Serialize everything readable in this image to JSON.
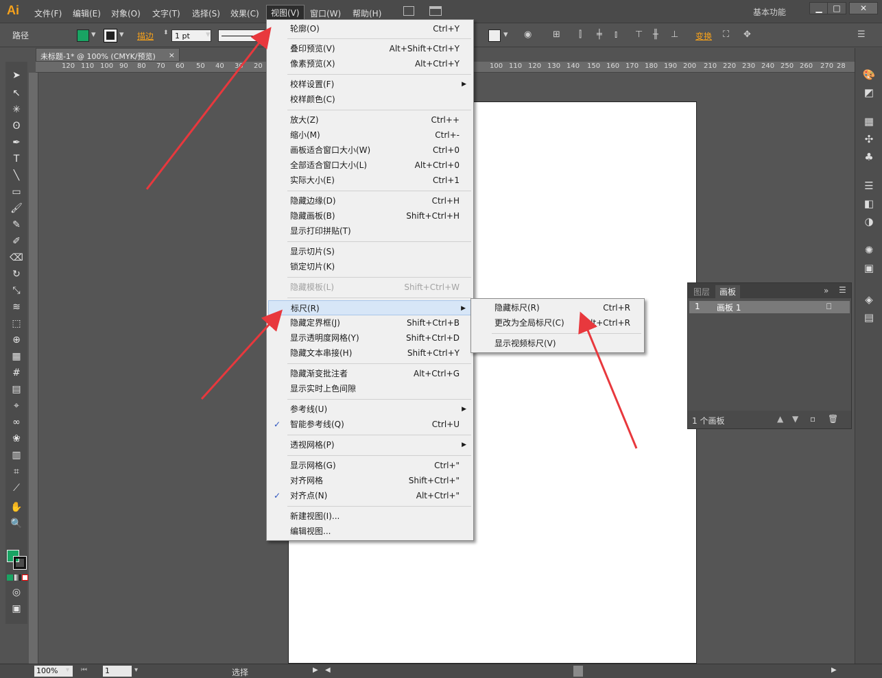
{
  "app": {
    "logo": "Ai",
    "workspace": "基本功能"
  },
  "menubar": [
    "文件(F)",
    "编辑(E)",
    "对象(O)",
    "文字(T)",
    "选择(S)",
    "效果(C)",
    "视图(V)",
    "窗口(W)",
    "帮助(H)"
  ],
  "controlbar": {
    "tool_name": "路径",
    "fill_color": "#19a463",
    "stroke_label": "描边",
    "stroke_weight": "1 pt",
    "transform_label": "变换"
  },
  "document": {
    "tab_title": "未标题-1* @ 100% (CMYK/预览)",
    "close": "×"
  },
  "ruler_top": [
    "120",
    "110",
    "100",
    "90",
    "80",
    "70",
    "60",
    "50",
    "40",
    "30",
    "20",
    "100",
    "110",
    "120",
    "130",
    "140",
    "150",
    "160",
    "170",
    "180",
    "190",
    "200",
    "210",
    "220",
    "230",
    "240",
    "250",
    "260",
    "270",
    "28"
  ],
  "view_menu": {
    "items": [
      {
        "label": "轮廓(O)",
        "shortcut": "Ctrl+Y"
      },
      {
        "label": "叠印预览(V)",
        "shortcut": "Alt+Shift+Ctrl+Y"
      },
      {
        "label": "像素预览(X)",
        "shortcut": "Alt+Ctrl+Y"
      },
      {
        "label": "校样设置(F)",
        "shortcut": ""
      },
      {
        "label": "校样颜色(C)",
        "shortcut": ""
      },
      {
        "label": "放大(Z)",
        "shortcut": "Ctrl++"
      },
      {
        "label": "缩小(M)",
        "shortcut": "Ctrl+-"
      },
      {
        "label": "画板适合窗口大小(W)",
        "shortcut": "Ctrl+0"
      },
      {
        "label": "全部适合窗口大小(L)",
        "shortcut": "Alt+Ctrl+0"
      },
      {
        "label": "实际大小(E)",
        "shortcut": "Ctrl+1"
      },
      {
        "label": "隐藏边缘(D)",
        "shortcut": "Ctrl+H"
      },
      {
        "label": "隐藏画板(B)",
        "shortcut": "Shift+Ctrl+H"
      },
      {
        "label": "显示打印拼贴(T)",
        "shortcut": ""
      },
      {
        "label": "显示切片(S)",
        "shortcut": ""
      },
      {
        "label": "锁定切片(K)",
        "shortcut": ""
      },
      {
        "label": "隐藏模板(L)",
        "shortcut": "Shift+Ctrl+W"
      },
      {
        "label": "标尺(R)",
        "shortcut": ""
      },
      {
        "label": "隐藏定界框(J)",
        "shortcut": "Shift+Ctrl+B"
      },
      {
        "label": "显示透明度网格(Y)",
        "shortcut": "Shift+Ctrl+D"
      },
      {
        "label": "隐藏文本串接(H)",
        "shortcut": "Shift+Ctrl+Y"
      },
      {
        "label": "隐藏渐变批注者",
        "shortcut": "Alt+Ctrl+G"
      },
      {
        "label": "显示实时上色间隙",
        "shortcut": ""
      },
      {
        "label": "参考线(U)",
        "shortcut": ""
      },
      {
        "label": "智能参考线(Q)",
        "shortcut": "Ctrl+U",
        "check": "✓"
      },
      {
        "label": "透视网格(P)",
        "shortcut": ""
      },
      {
        "label": "显示网格(G)",
        "shortcut": "Ctrl+\""
      },
      {
        "label": "对齐网格",
        "shortcut": "Shift+Ctrl+\""
      },
      {
        "label": "对齐点(N)",
        "shortcut": "Alt+Ctrl+\"",
        "check": "✓"
      },
      {
        "label": "新建视图(I)...",
        "shortcut": ""
      },
      {
        "label": "编辑视图...",
        "shortcut": ""
      }
    ]
  },
  "ruler_submenu": {
    "items": [
      {
        "label": "隐藏标尺(R)",
        "shortcut": "Ctrl+R"
      },
      {
        "label": "更改为全局标尺(C)",
        "shortcut": "Alt+Ctrl+R"
      },
      {
        "label": "显示视频标尺(V)",
        "shortcut": ""
      }
    ]
  },
  "artboards_panel": {
    "tabs": [
      "图层",
      "画板"
    ],
    "rows": [
      {
        "index": "1",
        "name": "画板 1"
      }
    ],
    "footer": "1 个画板"
  },
  "statusbar": {
    "zoom": "100%",
    "artboard_num": "1",
    "tool_status": "选择"
  },
  "colors": {
    "accent_orange": "#f7a21b",
    "fill_green": "#19a463",
    "menu_bg": "#f0f0f0",
    "arrow_red": "#e8383d"
  }
}
